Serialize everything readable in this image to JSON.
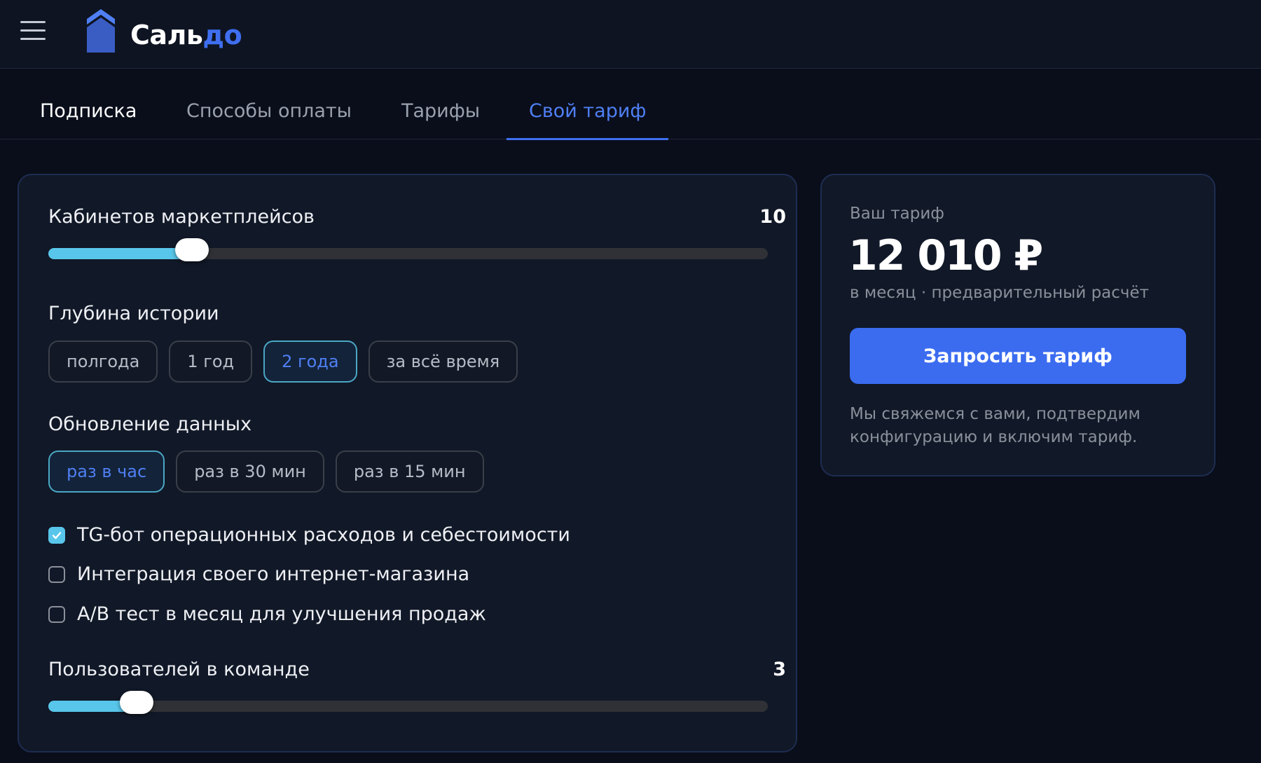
{
  "header": {
    "logo_part1": "Саль",
    "logo_part2": "до",
    "brand_color": "#3f6ff0"
  },
  "tabs": [
    {
      "label": "Подписка"
    },
    {
      "label": "Способы оплаты"
    },
    {
      "label": "Тарифы"
    },
    {
      "label": "Свой тариф",
      "active": true
    }
  ],
  "config": {
    "cabinets": {
      "label": "Кабинетов маркетплейсов",
      "value": "10",
      "fill_fraction": 0.2
    },
    "history": {
      "title": "Глубина истории",
      "options": [
        "полгода",
        "1 год",
        "2 года",
        "за всё время"
      ],
      "selected": "2 года"
    },
    "update": {
      "title": "Обновление данных",
      "options": [
        "раз в час",
        "раз в 30 мин",
        "раз в 15 мин"
      ],
      "selected": "раз в час"
    },
    "addons": [
      {
        "label": "TG-бот операционных расходов и себестоимости",
        "checked": true
      },
      {
        "label": "Интеграция своего интернет-магазина",
        "checked": false
      },
      {
        "label": "A/B тест в месяц для улучшения продаж",
        "checked": false
      }
    ],
    "users": {
      "label": "Пользователей в команде",
      "value": "3",
      "fill_fraction": 0.123
    }
  },
  "summary": {
    "label": "Ваш тариф",
    "price": "12 010 ₽",
    "sub": "в месяц · предварительный расчёт",
    "button": "Запросить тариф",
    "note": "Мы свяжемся с вами, подтвердим конфигурацию и включим тариф."
  },
  "colors": {
    "accent_blue": "#3b6cf0",
    "slider_fill": "#58c6ea",
    "background": "#0a0e1a"
  }
}
